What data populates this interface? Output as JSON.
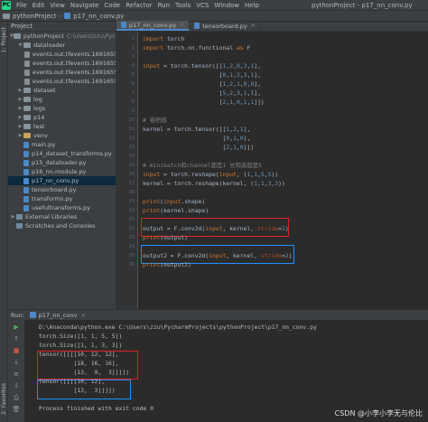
{
  "menubar": {
    "logo_text": "PC",
    "items": [
      "File",
      "Edit",
      "View",
      "Navigate",
      "Code",
      "Refactor",
      "Run",
      "Tools",
      "VCS",
      "Window",
      "Help"
    ],
    "window_title": "pythonProject - p17_nn_conv.py"
  },
  "breadcrumb": {
    "project": "pythonProject",
    "file": "p17_nn_conv.py"
  },
  "left_strip": {
    "project_label": "1: Project",
    "structure_label": "2: Favorites"
  },
  "project_panel": {
    "title": "Project",
    "tree": [
      {
        "label": "pythonProject",
        "suffix": "C:\\Users\\zzu\\Pychar",
        "kind": "folder",
        "arrow": "▼",
        "indent": 0
      },
      {
        "label": "dataloader",
        "kind": "folder",
        "arrow": "▼",
        "indent": 1
      },
      {
        "label": "events.out.tfevents.1691655",
        "kind": "event",
        "arrow": "",
        "indent": 2
      },
      {
        "label": "events.out.tfevents.1691655",
        "kind": "event",
        "arrow": "",
        "indent": 2
      },
      {
        "label": "events.out.tfevents.1691655",
        "kind": "event",
        "arrow": "",
        "indent": 2
      },
      {
        "label": "events.out.tfevents.1691655",
        "kind": "event",
        "arrow": "",
        "indent": 2
      },
      {
        "label": "dataset",
        "kind": "folder",
        "arrow": "▶",
        "indent": 1
      },
      {
        "label": "log",
        "kind": "folder",
        "arrow": "▶",
        "indent": 1
      },
      {
        "label": "logs",
        "kind": "folder",
        "arrow": "▶",
        "indent": 1
      },
      {
        "label": "p14",
        "kind": "folder",
        "arrow": "▶",
        "indent": 1
      },
      {
        "label": "test",
        "kind": "folder",
        "arrow": "▶",
        "indent": 1
      },
      {
        "label": "venv",
        "kind": "venv",
        "arrow": "▶",
        "indent": 1
      },
      {
        "label": "main.py",
        "kind": "py",
        "arrow": "",
        "indent": 1
      },
      {
        "label": "p14_dataset_transforms.py",
        "kind": "py",
        "arrow": "",
        "indent": 1
      },
      {
        "label": "p15_dataloader.py",
        "kind": "py",
        "arrow": "",
        "indent": 1
      },
      {
        "label": "p16_nn.module.py",
        "kind": "py",
        "arrow": "",
        "indent": 1
      },
      {
        "label": "p17_nn_conv.py",
        "kind": "py",
        "arrow": "",
        "indent": 1,
        "selected": true
      },
      {
        "label": "tensorboard.py",
        "kind": "py",
        "arrow": "",
        "indent": 1
      },
      {
        "label": "transforms.py",
        "kind": "py",
        "arrow": "",
        "indent": 1
      },
      {
        "label": "usefultransforms.py",
        "kind": "py",
        "arrow": "",
        "indent": 1
      },
      {
        "label": "External Libraries",
        "kind": "lib",
        "arrow": "▶",
        "indent": 0
      },
      {
        "label": "Scratches and Consoles",
        "kind": "lib",
        "arrow": "",
        "indent": 0
      }
    ]
  },
  "editor": {
    "tabs": [
      {
        "label": "p17_nn_conv.py",
        "active": true
      },
      {
        "label": "tensorboard.py",
        "active": false
      }
    ],
    "tab_close": "×",
    "lines": [
      {
        "n": "1",
        "html": "<span class=\"kw\">import</span> torch"
      },
      {
        "n": "2",
        "html": "<span class=\"kw\">import</span> torch.nn.functional <span class=\"kw\">as</span> F"
      },
      {
        "n": "3",
        "html": ""
      },
      {
        "n": "4",
        "html": "<span class=\"kw\">input</span> = torch.tensor([[<span class=\"num\">1</span>,<span class=\"num\">2</span>,<span class=\"num\">0</span>,<span class=\"num\">3</span>,<span class=\"num\">1</span>],"
      },
      {
        "n": "5",
        "html": "                      [<span class=\"num\">0</span>,<span class=\"num\">1</span>,<span class=\"num\">2</span>,<span class=\"num\">3</span>,<span class=\"num\">1</span>],"
      },
      {
        "n": "6",
        "html": "                      [<span class=\"num\">1</span>,<span class=\"num\">2</span>,<span class=\"num\">1</span>,<span class=\"num\">0</span>,<span class=\"num\">0</span>],"
      },
      {
        "n": "7",
        "html": "                      [<span class=\"num\">5</span>,<span class=\"num\">2</span>,<span class=\"num\">3</span>,<span class=\"num\">1</span>,<span class=\"num\">1</span>],"
      },
      {
        "n": "8",
        "html": "                      [<span class=\"num\">2</span>,<span class=\"num\">1</span>,<span class=\"num\">0</span>,<span class=\"num\">1</span>,<span class=\"num\">1</span>]])"
      },
      {
        "n": "9",
        "html": ""
      },
      {
        "n": "10",
        "html": "<span class=\"cmt\"># 卷积核</span>"
      },
      {
        "n": "11",
        "html": "kernel = torch.tensor([[<span class=\"num\">1</span>,<span class=\"num\">2</span>,<span class=\"num\">1</span>],"
      },
      {
        "n": "12",
        "html": "                       [<span class=\"num\">0</span>,<span class=\"num\">1</span>,<span class=\"num\">0</span>],"
      },
      {
        "n": "13",
        "html": "                       [<span class=\"num\">2</span>,<span class=\"num\">1</span>,<span class=\"num\">0</span>]])"
      },
      {
        "n": "14",
        "html": ""
      },
      {
        "n": "15",
        "html": "<span class=\"cmt\"># minibatch和channel都是1 长和高都是5</span>"
      },
      {
        "n": "16",
        "html": "<span class=\"kw\">input</span> = torch.reshape(<span class=\"kw\">input</span>, (<span class=\"num\">1</span>,<span class=\"num\">1</span>,<span class=\"num\">5</span>,<span class=\"num\">5</span>))"
      },
      {
        "n": "17",
        "html": "kernel = torch.reshape(kernel, (<span class=\"num\">1</span>,<span class=\"num\">1</span>,<span class=\"num\">3</span>,<span class=\"num\">3</span>))"
      },
      {
        "n": "18",
        "html": ""
      },
      {
        "n": "19",
        "html": "<span class=\"kw\">print</span>(<span class=\"kw\">input</span>.shape)"
      },
      {
        "n": "20",
        "html": "<span class=\"kw\">print</span>(kernel.shape)"
      },
      {
        "n": "21",
        "html": ""
      },
      {
        "n": "22",
        "html": "output = F.conv2d(<span class=\"kw\">input</span>, kernel, <span class=\"param\">stride</span>=<span class=\"num\">1</span>)"
      },
      {
        "n": "23",
        "html": "<span class=\"kw\">print</span>(output)"
      },
      {
        "n": "24",
        "html": ""
      },
      {
        "n": "25",
        "html": "output2 = F.conv2d(<span class=\"kw\">input</span>, kernel, <span class=\"param\">stride</span>=<span class=\"num\">2</span>)"
      },
      {
        "n": "26",
        "html": "<span class=\"kw\">print</span>(output2)"
      }
    ]
  },
  "run_panel": {
    "label": "Run:",
    "tab": "p17_nn_conv",
    "tab_close": "×",
    "tools": [
      "▶",
      "↑",
      "■",
      "↓",
      "≡",
      "⇩",
      "⎙",
      "🗑"
    ],
    "lines": [
      "D:\\Anaconda\\python.exe C:\\Users\\zzu\\PycharmProjects\\pythonProject\\p17_nn_conv.py",
      "torch.Size([1, 1, 5, 5])",
      "torch.Size([1, 1, 3, 3])",
      "tensor([[[[10, 12, 12],",
      "          [18, 16, 16],",
      "          [13,  9,  3]]]])",
      "tensor([[[[10, 12],",
      "          [13,  3]]]])",
      "",
      "Process finished with exit code 0"
    ]
  },
  "watermark": "CSDN @小李小李无与伦比",
  "colors": {
    "highlight_red": "#e02020",
    "highlight_blue": "#1e90ff",
    "keyword": "#cc7832",
    "number": "#6897bb",
    "comment": "#808080"
  }
}
